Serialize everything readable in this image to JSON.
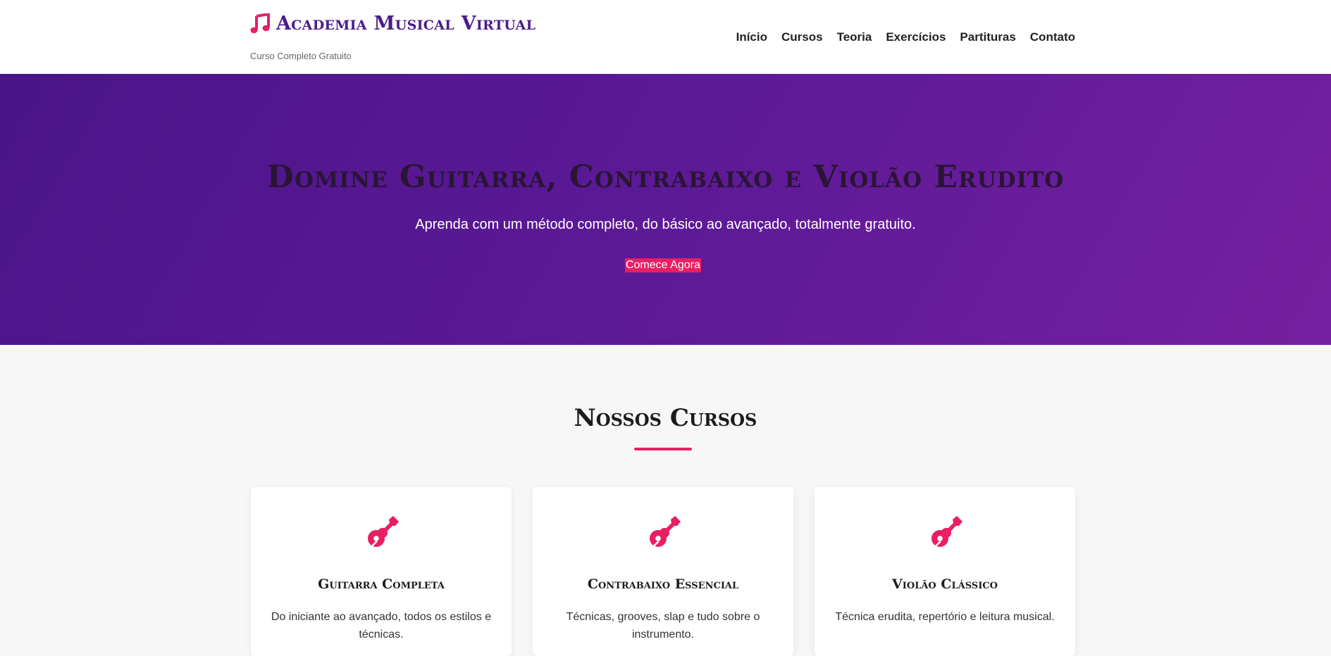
{
  "header": {
    "site_title": "Academia Musical Virtual",
    "tagline": "Curso Completo Gratuito",
    "logo_icon": "music-note-icon",
    "nav": [
      {
        "label": "Início"
      },
      {
        "label": "Cursos"
      },
      {
        "label": "Teoria"
      },
      {
        "label": "Exercícios"
      },
      {
        "label": "Partituras"
      },
      {
        "label": "Contato"
      }
    ]
  },
  "hero": {
    "title": "Domine Guitarra, Contrabaixo e Violão Erudito",
    "subtitle": "Aprenda com um método completo, do básico ao avançado, totalmente gratuito.",
    "cta_label": "Comece Agora"
  },
  "courses": {
    "section_title": "Nossos Cursos",
    "items": [
      {
        "icon": "guitar-icon",
        "name": "Guitarra Completa",
        "description": "Do iniciante ao avançado, todos os estilos e técnicas."
      },
      {
        "icon": "guitar-icon",
        "name": "Contrabaixo Essencial",
        "description": "Técnicas, grooves, slap e tudo sobre o instrumento."
      },
      {
        "icon": "guitar-icon",
        "name": "Violão Clássico",
        "description": "Técnica erudita, repertório e leitura musical."
      }
    ]
  },
  "colors": {
    "brand_purple": "#4a1a8c",
    "accent_pink": "#e91e63",
    "hero_gradient_start": "#4a1589",
    "hero_gradient_end": "#7520a0"
  }
}
